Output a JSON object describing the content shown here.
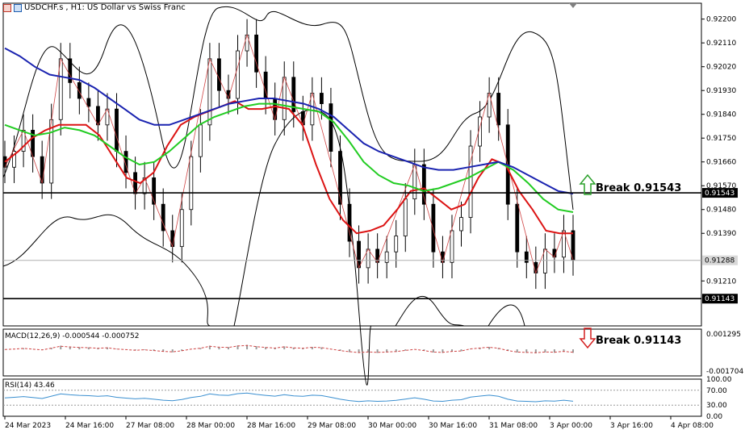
{
  "header": {
    "symbol": "USDCHF.s",
    "timeframe": "H1:",
    "description": "US Dollar vs Swiss Franc"
  },
  "colors": {
    "candle": "#000000",
    "bollinger": "#000000",
    "ma_fast": "#dc1414",
    "ma_mid": "#22cc22",
    "ma_slow": "#1a23b0",
    "zigzag": "#d04545",
    "macd_hist": "#9a9a9a",
    "macd_signal": "#d04545",
    "rsi_line": "#3a8fd0",
    "arrow_up": "#2aa02a",
    "arrow_down": "#d41e1e",
    "level_line": "#000000",
    "current_price_line": "#b0b0b0"
  },
  "annotations": {
    "break_up": "Break 0.91543",
    "break_down": "Break 0.91143"
  },
  "chart_data": [
    {
      "type": "line",
      "panel": "price",
      "ylim": [
        0.9104,
        0.9226
      ],
      "y_ticks": [
        "0.92200",
        "0.92110",
        "0.92020",
        "0.91930",
        "0.91840",
        "0.91750",
        "0.91660",
        "0.91570",
        "0.91480",
        "0.91390",
        "0.91210"
      ],
      "y_tick_values": [
        0.922,
        0.9211,
        0.9202,
        0.9193,
        0.9184,
        0.9175,
        0.9166,
        0.9157,
        0.9148,
        0.9139,
        0.9121
      ],
      "price_labels": [
        {
          "text": "0.91543",
          "value": 0.91543,
          "style": "level"
        },
        {
          "text": "0.91288",
          "value": 0.91288,
          "style": "current"
        },
        {
          "text": "0.91143",
          "value": 0.91143,
          "style": "level"
        }
      ],
      "x_ticks": [
        "24 Mar 2023",
        "24 Mar 16:00",
        "27 Mar 08:00",
        "28 Mar 00:00",
        "28 Mar 16:00",
        "29 Mar 08:00",
        "30 Mar 00:00",
        "30 Mar 16:00",
        "31 Mar 08:00",
        "3 Apr 00:00",
        "3 Apr 16:00",
        "4 Apr 08:00"
      ],
      "close": [
        0.9164,
        0.917,
        0.9178,
        0.9168,
        0.9158,
        0.9182,
        0.9205,
        0.9196,
        0.919,
        0.9187,
        0.918,
        0.9186,
        0.917,
        0.9162,
        0.9154,
        0.916,
        0.915,
        0.914,
        0.9134,
        0.9148,
        0.9168,
        0.918,
        0.9205,
        0.9193,
        0.919,
        0.9208,
        0.9214,
        0.92,
        0.919,
        0.9182,
        0.9198,
        0.9185,
        0.918,
        0.9192,
        0.9188,
        0.917,
        0.915,
        0.9136,
        0.9126,
        0.9133,
        0.9128,
        0.9132,
        0.9138,
        0.9152,
        0.9165,
        0.915,
        0.9132,
        0.9128,
        0.914,
        0.9145,
        0.9172,
        0.9183,
        0.9192,
        0.918,
        0.915,
        0.9132,
        0.9128,
        0.9124,
        0.9133,
        0.913,
        0.914,
        0.9129
      ],
      "series": [
        {
          "name": "MA fast",
          "values": [
            0.9166,
            0.917,
            0.9175,
            0.9178,
            0.918,
            0.918,
            0.918,
            0.9176,
            0.9168,
            0.916,
            0.9158,
            0.9162,
            0.9172,
            0.918,
            0.9183,
            0.9185,
            0.9187,
            0.9189,
            0.9186,
            0.9186,
            0.9187,
            0.9186,
            0.918,
            0.9165,
            0.9152,
            0.9144,
            0.9139,
            0.914,
            0.9142,
            0.9148,
            0.9155,
            0.9156,
            0.9152,
            0.9148,
            0.915,
            0.916,
            0.9167,
            0.9165,
            0.9155,
            0.9148,
            0.914,
            0.9139,
            0.9139
          ]
        },
        {
          "name": "MA mid",
          "values": [
            0.918,
            0.9178,
            0.9176,
            0.9177,
            0.9179,
            0.9178,
            0.9176,
            0.9172,
            0.9168,
            0.9165,
            0.9166,
            0.917,
            0.9175,
            0.918,
            0.9183,
            0.9185,
            0.9187,
            0.9188,
            0.9188,
            0.9187,
            0.9186,
            0.9185,
            0.9181,
            0.9174,
            0.9166,
            0.9161,
            0.9158,
            0.9157,
            0.9155,
            0.9156,
            0.9158,
            0.916,
            0.9163,
            0.9166,
            0.9163,
            0.9158,
            0.9152,
            0.9148,
            0.9147
          ]
        },
        {
          "name": "MA slow",
          "values": [
            0.9209,
            0.9206,
            0.9202,
            0.9199,
            0.9198,
            0.9197,
            0.9194,
            0.919,
            0.9186,
            0.9182,
            0.918,
            0.918,
            0.9182,
            0.9184,
            0.9186,
            0.9188,
            0.9189,
            0.919,
            0.919,
            0.9189,
            0.9188,
            0.9186,
            0.9183,
            0.9178,
            0.9173,
            0.917,
            0.9168,
            0.9166,
            0.9164,
            0.9163,
            0.9163,
            0.9164,
            0.9165,
            0.9166,
            0.9164,
            0.9161,
            0.9158,
            0.9155,
            0.9154
          ]
        }
      ]
    },
    {
      "type": "bar",
      "panel": "macd",
      "label": "MACD(12,26,9) -0.000544 -0.000752",
      "y_ticks": [
        "0.001295",
        "-0.001704"
      ],
      "ylim": [
        -0.001704,
        0.001295
      ]
    },
    {
      "type": "line",
      "panel": "rsi",
      "label": "RSI(14) 43.46",
      "y_ticks": [
        "100.00",
        "70.00",
        "30.00",
        "0.00"
      ],
      "ylim": [
        0,
        100
      ],
      "levels": [
        70,
        30
      ]
    }
  ]
}
